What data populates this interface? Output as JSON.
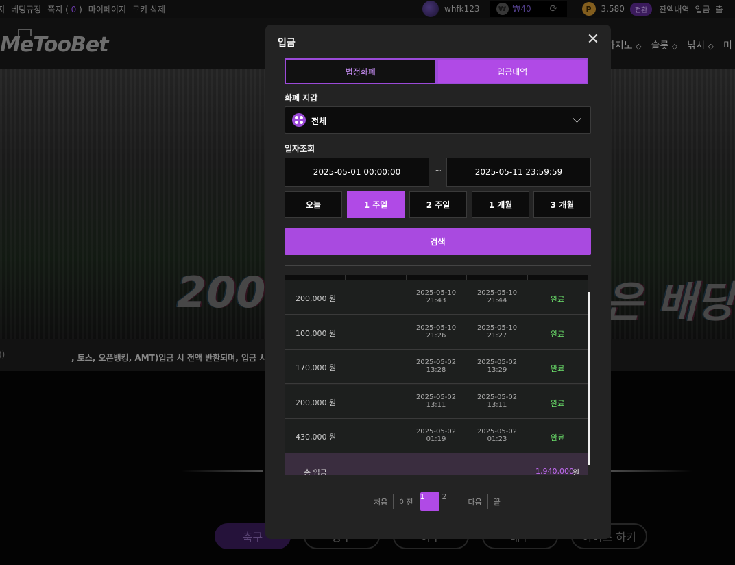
{
  "topbar": {
    "links": [
      "지",
      "베팅규정",
      "쪽지 (",
      "0",
      ")",
      "마이페이지",
      "쿠키 삭제"
    ],
    "username": "whfk123",
    "wallet_amount": "₩40",
    "points": "3,580",
    "points_badge": "전환",
    "right_links": [
      "잔액내역",
      "입금",
      "출"
    ]
  },
  "header": {
    "logo": "MeTooBet",
    "nav": [
      "카지노",
      "슬롯",
      "낚시",
      "미"
    ]
  },
  "banner": {
    "text_left": "200",
    "text_right": "은 배당"
  },
  "notice": {
    "text": ", 토스, 오픈뱅킹, AMT)입금 시 전액 반환되며, 입금 시 연"
  },
  "categories": [
    "축구",
    "농구",
    "야구",
    "배구",
    "아이스 하키"
  ],
  "modal": {
    "title": "입금",
    "tabs": [
      "법정화폐",
      "입금내역"
    ],
    "wallet_label": "화폐 지갑",
    "wallet_value": "전체",
    "date_label": "일자조회",
    "date_from": "2025-05-01 00:00:00",
    "date_tilde": "~",
    "date_to": "2025-05-11 23:59:59",
    "quick": [
      "오늘",
      "1 주일",
      "2 주일",
      "1 개월",
      "3 개월"
    ],
    "quick_active": 1,
    "search_label": "검색",
    "rows": [
      {
        "amount": "200,000 원",
        "req_date": "2025-05-10",
        "req_time": "21:43",
        "done_date": "2025-05-10",
        "done_time": "21:44",
        "status": "완료"
      },
      {
        "amount": "100,000 원",
        "req_date": "2025-05-10",
        "req_time": "21:26",
        "done_date": "2025-05-10",
        "done_time": "21:27",
        "status": "완료"
      },
      {
        "amount": "170,000 원",
        "req_date": "2025-05-02",
        "req_time": "13:28",
        "done_date": "2025-05-02",
        "done_time": "13:29",
        "status": "완료"
      },
      {
        "amount": "200,000 원",
        "req_date": "2025-05-02",
        "req_time": "13:11",
        "done_date": "2025-05-02",
        "done_time": "13:11",
        "status": "완료"
      },
      {
        "amount": "430,000 원",
        "req_date": "2025-05-02",
        "req_time": "01:19",
        "done_date": "2025-05-02",
        "done_time": "01:23",
        "status": "완료"
      }
    ],
    "total_label": "총 입금",
    "total_value": "1,940,000",
    "total_unit": "원",
    "pager": {
      "first": "처음",
      "prev": "이전",
      "pages": [
        "1",
        "2"
      ],
      "next": "다음",
      "last": "끝"
    },
    "colors": {
      "accent": "#b04ae6",
      "complete": "#6be06b"
    }
  }
}
